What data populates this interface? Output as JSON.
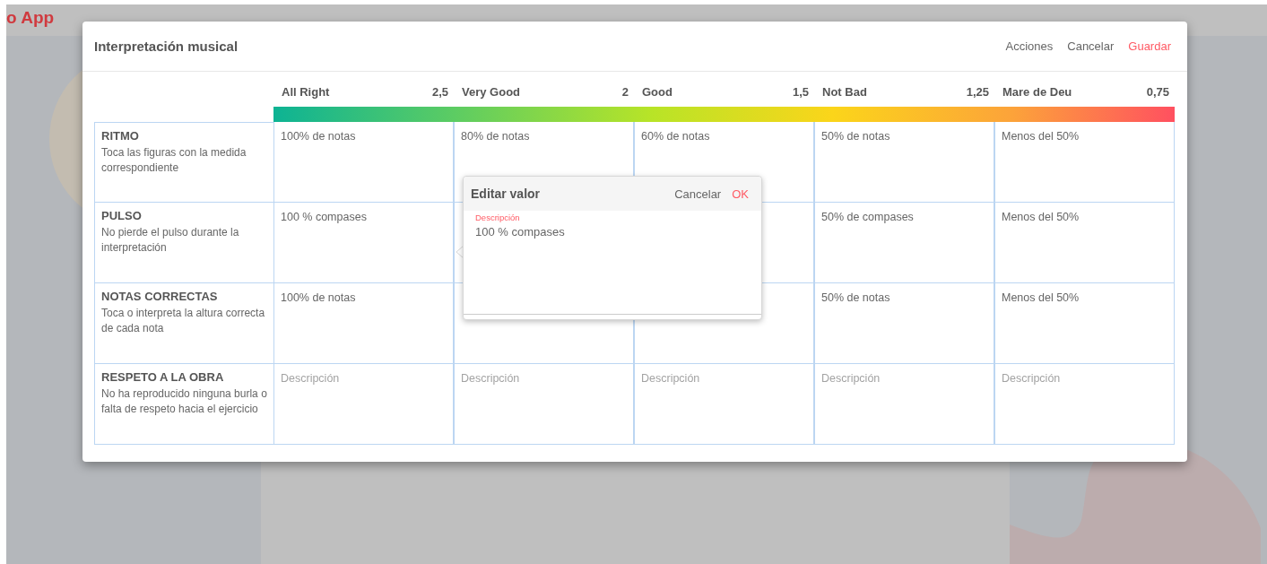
{
  "background_app": {
    "title": "o App"
  },
  "dialog": {
    "title": "Interpretación musical",
    "actions": [
      {
        "label": "Acciones",
        "kind": "plain"
      },
      {
        "label": "Cancelar",
        "kind": "plain"
      },
      {
        "label": "Guardar",
        "kind": "primary"
      }
    ],
    "levels": [
      {
        "label": "All Right",
        "score": "2,5"
      },
      {
        "label": "Very Good",
        "score": "2"
      },
      {
        "label": "Good",
        "score": "1,5"
      },
      {
        "label": "Not Bad",
        "score": "1,25"
      },
      {
        "label": "Mare de Deu",
        "score": "0,75"
      }
    ],
    "criteria": [
      {
        "name": "RITMO",
        "description": "Toca las figuras con la medida correspondiente",
        "cells": [
          {
            "text": "100% de notas"
          },
          {
            "text": "80% de notas"
          },
          {
            "text": "60% de notas"
          },
          {
            "text": "50% de notas"
          },
          {
            "text": "Menos del 50%"
          }
        ]
      },
      {
        "name": "PULSO",
        "description": "No pierde el pulso durante la interpretación",
        "cells": [
          {
            "text": "100 % compases"
          },
          null,
          null,
          {
            "text": "50% de compases"
          },
          {
            "text": "Menos del 50%"
          }
        ]
      },
      {
        "name": "NOTAS CORRECTAS",
        "description": "Toca o interpreta la altura correcta de cada nota",
        "cells": [
          {
            "text": "100% de notas"
          },
          null,
          null,
          {
            "text": "50% de notas"
          },
          {
            "text": "Menos del 50%"
          }
        ]
      },
      {
        "name": "RESPETO A LA OBRA",
        "description": "No ha reproducido ninguna burla o falta de respeto hacia el ejercicio",
        "cells": [
          {
            "placeholder": "Descripción"
          },
          {
            "placeholder": "Descripción"
          },
          {
            "placeholder": "Descripción"
          },
          {
            "placeholder": "Descripción"
          },
          {
            "placeholder": "Descripción"
          }
        ]
      }
    ]
  },
  "popover": {
    "title": "Editar valor",
    "buttons": [
      {
        "label": "Cancelar",
        "kind": "plain"
      },
      {
        "label": "OK",
        "kind": "primary"
      }
    ],
    "field": {
      "label": "Descripción",
      "value": "100 % compases"
    }
  }
}
